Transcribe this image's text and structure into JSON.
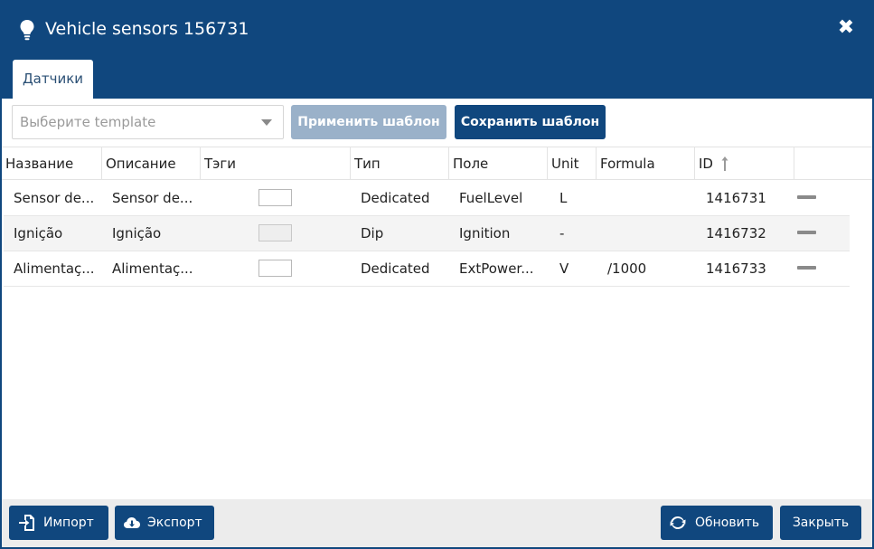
{
  "window": {
    "title": "Vehicle sensors 156731",
    "close_glyph": "✖",
    "title_icon": "lightbulb-icon"
  },
  "tabs": [
    {
      "label": "Датчики",
      "active": true
    }
  ],
  "toolbar": {
    "template_select_placeholder": "Выберите template",
    "apply_label": "Применить шаблон",
    "save_label": "Сохранить шаблон"
  },
  "table": {
    "columns": [
      "Название",
      "Описание",
      "Тэги",
      "Тип",
      "Поле",
      "Unit",
      "Formula",
      "ID"
    ],
    "sort": {
      "column": "ID",
      "direction": "ascending",
      "icon": "arrow-up-icon"
    },
    "rows": [
      {
        "name": "Sensor de...",
        "description": "Sensor de...",
        "type": "Dedicated",
        "field": "FuelLevel",
        "unit": "L",
        "formula": "",
        "id": "1416731"
      },
      {
        "name": "Ignição",
        "description": "Ignição",
        "type": "Dip",
        "field": "Ignition",
        "unit": "-",
        "formula": "",
        "id": "1416732"
      },
      {
        "name": "Alimentaç...",
        "description": "Alimentaç...",
        "type": "Dedicated",
        "field": "ExtPower...",
        "unit": "V",
        "formula": "/1000",
        "id": "1416733"
      }
    ]
  },
  "footer": {
    "import_label": "Импорт",
    "export_label": "Экспорт",
    "refresh_label": "Обновить",
    "close_label": "Закрыть"
  },
  "colors": {
    "primary": "#10477e",
    "disabled_button": "#9ab1c9",
    "footer_bg": "#ececec"
  }
}
